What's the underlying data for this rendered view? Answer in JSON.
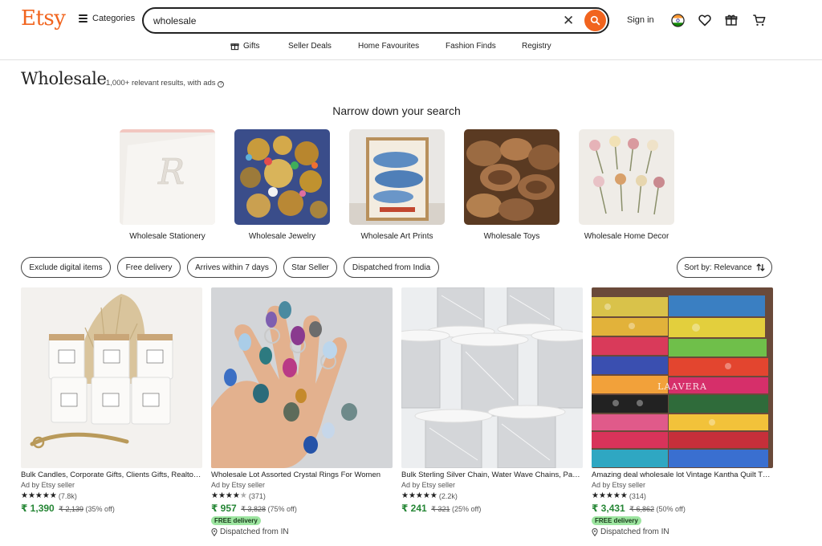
{
  "header": {
    "logo": "Etsy",
    "categories_label": "Categories",
    "search_value": "wholesale",
    "sign_in": "Sign in"
  },
  "subnav": [
    "Gifts",
    "Seller Deals",
    "Home Favourites",
    "Fashion Finds",
    "Registry"
  ],
  "page": {
    "title": "Wholesale",
    "results": "1,000+ relevant results, with ads",
    "narrow_heading": "Narrow down your search"
  },
  "categories": [
    {
      "label": "Wholesale Stationery"
    },
    {
      "label": "Wholesale Jewelry"
    },
    {
      "label": "Wholesale Art Prints"
    },
    {
      "label": "Wholesale Toys"
    },
    {
      "label": "Wholesale Home Decor"
    }
  ],
  "filters": [
    "Exclude digital items",
    "Free delivery",
    "Arrives within 7 days",
    "Star Seller",
    "Dispatched from India"
  ],
  "sort": {
    "label": "Sort by: Relevance"
  },
  "listings": [
    {
      "title": "Bulk Candles, Corporate Gifts, Clients Gifts, Realtor Closing Gifts",
      "ad": "Ad by Etsy seller",
      "rating_count": "(7.8k)",
      "stars": 5,
      "price": "₹ 1,390",
      "original_price": "₹ 2,139",
      "discount": "(35% off)"
    },
    {
      "title": "Wholesale Lot Assorted Crystal Rings For Women",
      "ad": "Ad by Etsy seller",
      "rating_count": "(371)",
      "stars": 4.5,
      "price": "₹ 957",
      "original_price": "₹ 3,828",
      "discount": "(75% off)",
      "free_delivery": "FREE delivery",
      "dispatched": "Dispatched from IN"
    },
    {
      "title": "Bulk Sterling Silver Chain, Water Wave Chains, Paperclip Chain",
      "ad": "Ad by Etsy seller",
      "rating_count": "(2.2k)",
      "stars": 5,
      "price": "₹ 241",
      "original_price": "₹ 321",
      "discount": "(25% off)"
    },
    {
      "title": "Amazing deal wholesale lot Vintage Kantha Quilt Throw",
      "ad": "Ad by Etsy seller",
      "rating_count": "(314)",
      "stars": 5,
      "price": "₹ 3,431",
      "original_price": "₹ 6,862",
      "discount": "(50% off)",
      "free_delivery": "FREE delivery",
      "dispatched": "Dispatched from IN",
      "image_watermark": "LAAVERA"
    }
  ],
  "colors": {
    "brand": "#f1641e",
    "price_green": "#258635",
    "free_badge": "#9de5a0"
  },
  "icons": [
    "hamburger-icon",
    "clear-icon",
    "search-icon",
    "india-flag-icon",
    "heart-icon",
    "gift-icon",
    "cart-icon",
    "location-pin-icon",
    "sort-icon",
    "info-icon"
  ]
}
